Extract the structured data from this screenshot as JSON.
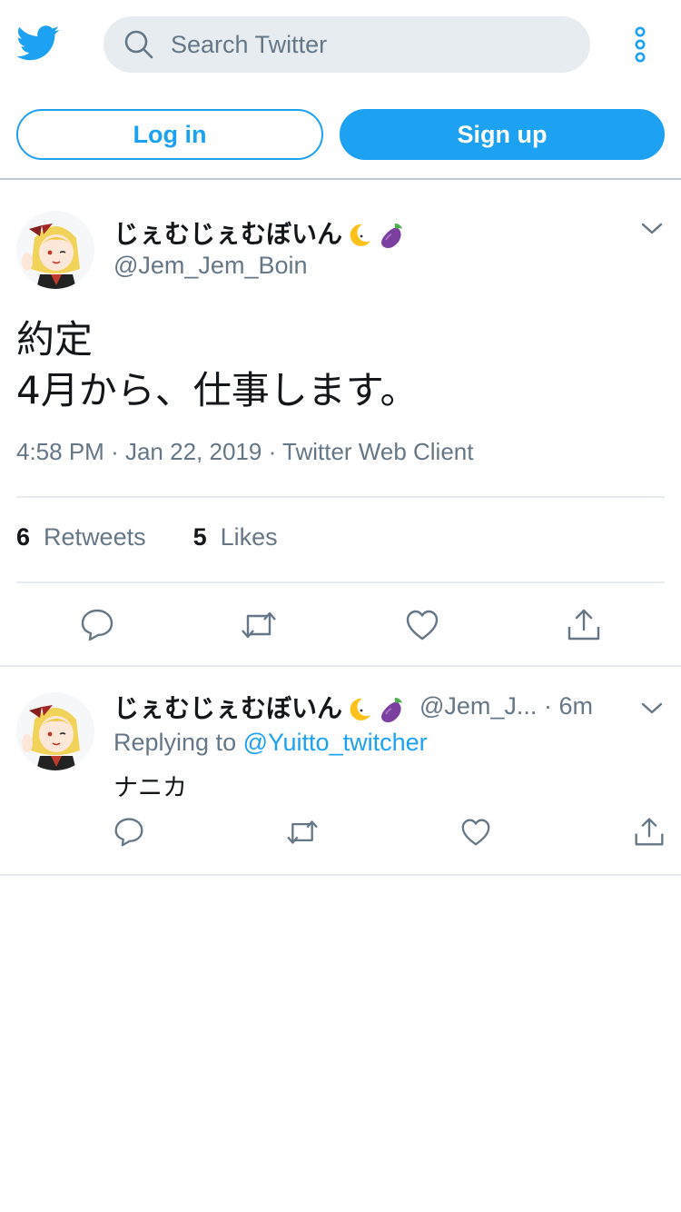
{
  "header": {
    "search_placeholder": "Search Twitter",
    "login_label": "Log in",
    "signup_label": "Sign up",
    "brand_color": "#1da1f2"
  },
  "main_tweet": {
    "display_name": "じぇむじぇむぼいん",
    "handle": "@Jem_Jem_Boin",
    "text": "約定\n4月から、仕事します。",
    "time": "4:58 PM",
    "date": "Jan 22, 2019",
    "client": "Twitter Web Client",
    "dot": "·",
    "retweet_count": "6",
    "retweet_label": "Retweets",
    "like_count": "5",
    "like_label": "Likes"
  },
  "reply_tweet": {
    "display_name": "じぇむじぇむぼいん",
    "handle": "@Jem_J...",
    "dot": "·",
    "age": "6m",
    "replying_prefix": "Replying to",
    "replying_to": "@Yuitto_twitcher",
    "text": "ナニカ"
  },
  "icons": {
    "logo": "twitter-bird-icon",
    "search": "search-icon",
    "menu": "more-vertical-icon",
    "caret": "chevron-down-icon",
    "reply": "reply-icon",
    "retweet": "retweet-icon",
    "like": "heart-icon",
    "share": "share-icon"
  }
}
